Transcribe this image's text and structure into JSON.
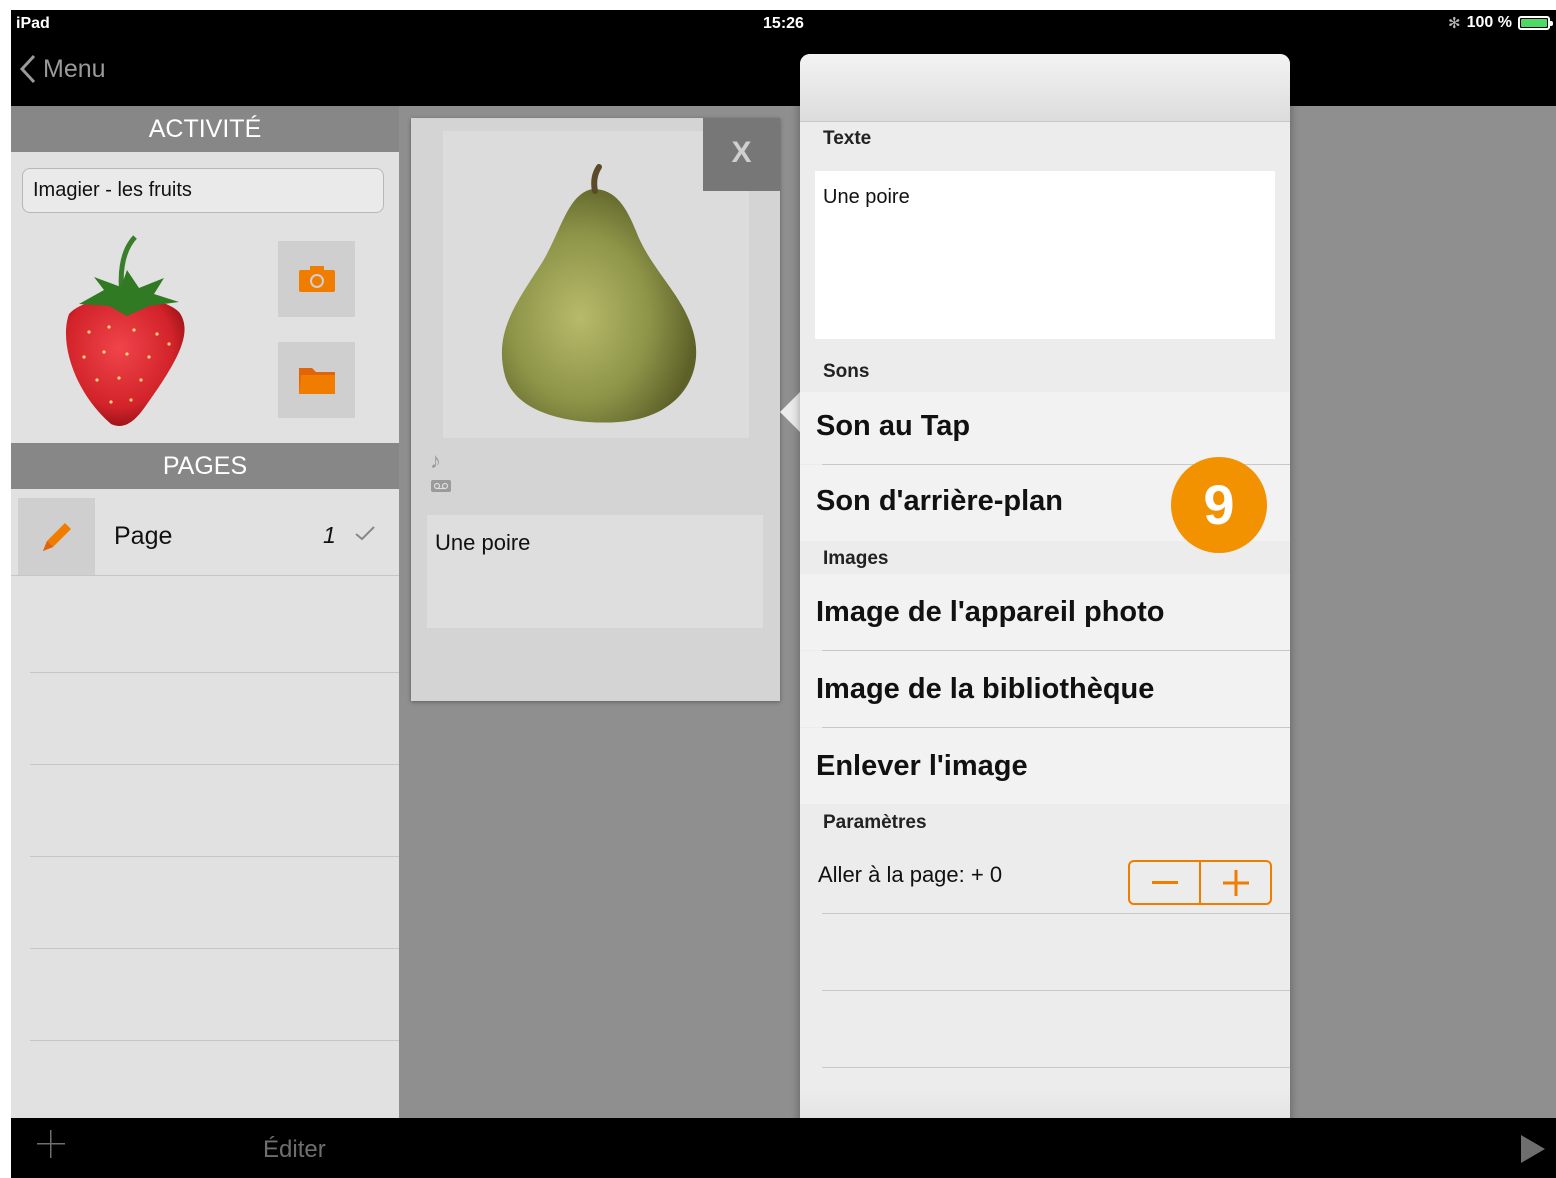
{
  "status_bar": {
    "device": "iPad",
    "time": "15:26",
    "battery": "100 %"
  },
  "nav": {
    "back_label": "Menu"
  },
  "sidebar": {
    "activity_header": "ACTIVITÉ",
    "activity_name": "Imagier - les fruits",
    "pages_header": "PAGES",
    "pages": [
      {
        "label": "Page",
        "number": "1"
      }
    ]
  },
  "page_card": {
    "close_label": "X",
    "text": "Une poire"
  },
  "popover": {
    "texte_header": "Texte",
    "texte_value": "Une poire",
    "sons_header": "Sons",
    "son_tap": "Son au Tap",
    "son_arriere": "Son d'arrière-plan",
    "images_header": "Images",
    "image_camera": "Image de l'appareil photo",
    "image_library": "Image de la bibliothèque",
    "image_remove": "Enlever l'image",
    "params_header": "Paramètres",
    "goto_page": "Aller à la page: + 0"
  },
  "badge": "9",
  "toolbar": {
    "edit_label": "Éditer"
  },
  "colors": {
    "accent": "#f07d00",
    "badge": "#f39200"
  },
  "icons": [
    "chevron-left-icon",
    "camera-icon",
    "folder-icon",
    "pencil-icon",
    "checkmark-icon",
    "music-note-icon",
    "voicemail-icon",
    "minus-icon",
    "plus-icon",
    "play-icon",
    "bluetooth-icon",
    "battery-icon"
  ]
}
